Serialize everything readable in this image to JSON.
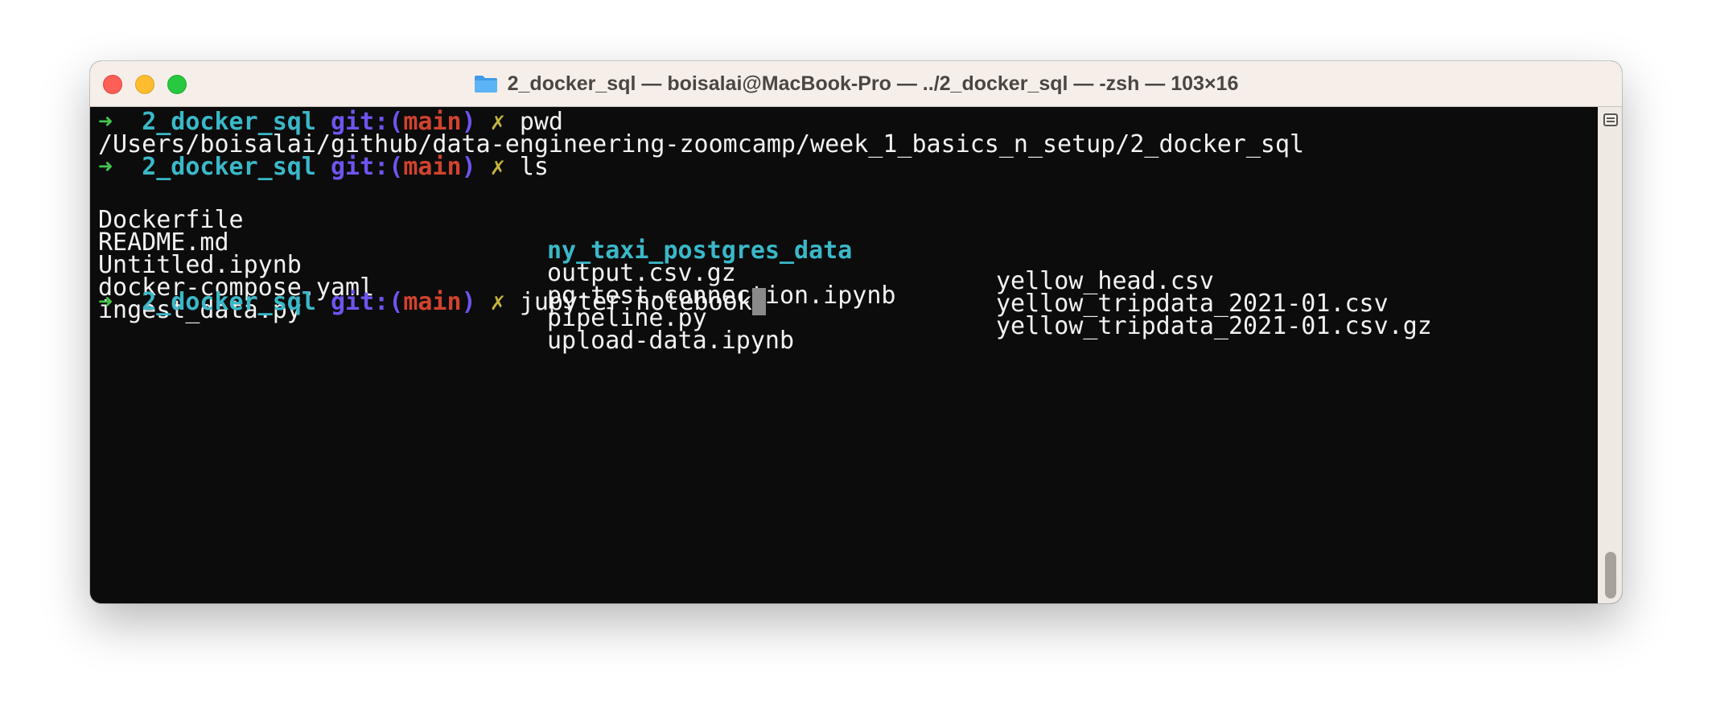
{
  "window": {
    "title": "2_docker_sql — boisalai@MacBook-Pro — ../2_docker_sql — -zsh — 103×16",
    "icon": "folder-icon",
    "traffic_lights": {
      "close": "#ff5f57",
      "minimize": "#febc2e",
      "maximize": "#28c840"
    }
  },
  "colors": {
    "background": "#0c0c0c",
    "foreground": "#f2f2f2",
    "prompt_arrow": "#45c44b",
    "directory": "#3ab8c8",
    "git_label": "#6d55f0",
    "branch": "#d0432e",
    "dirty_mark": "#c4b43a"
  },
  "prompt": {
    "arrow": "➜",
    "dir": "2_docker_sql",
    "git_open": "git:(",
    "branch": "main",
    "git_close": ")",
    "dirty": "✗"
  },
  "terminal": {
    "cmd1": "pwd",
    "pwd_output": "/Users/boisalai/github/data-engineering-zoomcamp/week_1_basics_n_setup/2_docker_sql",
    "cmd2": "ls",
    "ls_output": {
      "col1": [
        "Dockerfile",
        "README.md",
        "Untitled.ipynb",
        "docker-compose.yaml",
        "ingest_data.py"
      ],
      "col2": [
        "ny_taxi_postgres_data",
        "output.csv.gz",
        "pg-test-connection.ipynb",
        "pipeline.py",
        "upload-data.ipynb"
      ],
      "col3": [
        "yellow_head.csv",
        "yellow_tripdata_2021-01.csv",
        "yellow_tripdata_2021-01.csv.gz"
      ]
    },
    "cmd3": "jupyter notebook"
  }
}
